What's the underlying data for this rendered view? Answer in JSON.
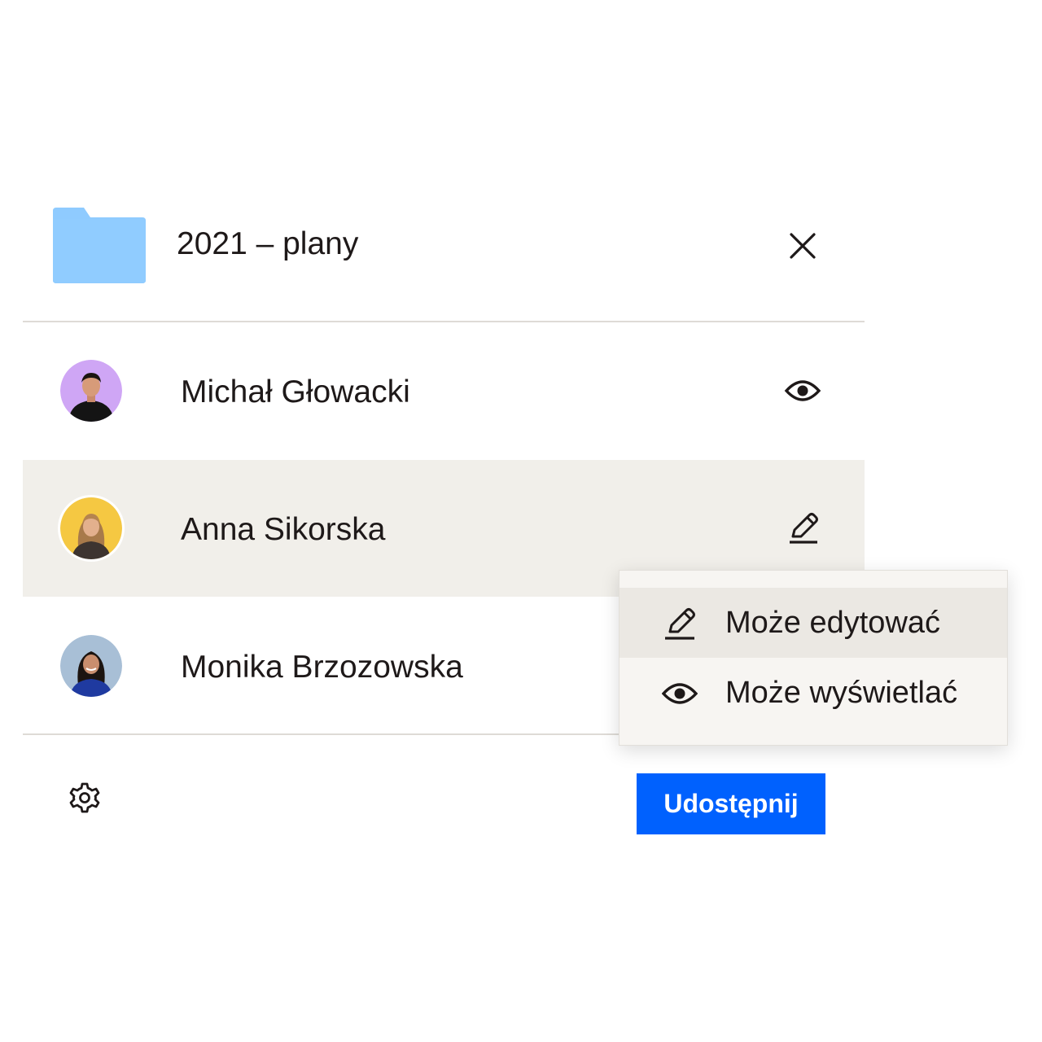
{
  "dialog": {
    "folder_name": "2021 – plany",
    "folder_icon": "folder-icon",
    "close_icon": "close-icon",
    "colors": {
      "folder": "#8fcbff",
      "accent": "#0061fe",
      "selected_row": "#f1efea"
    }
  },
  "members": [
    {
      "name": "Michał Głowacki",
      "permission_icon": "eye-icon",
      "avatar_color": "#cfa6f5"
    },
    {
      "name": "Anna Sikorska",
      "permission_icon": "pencil-icon",
      "avatar_color": "#f5c842",
      "selected": true
    },
    {
      "name": "Monika Brzozowska",
      "permission_icon": "",
      "avatar_color": "#a8bfd6"
    }
  ],
  "permission_menu": {
    "options": [
      {
        "label": "Może edytować",
        "icon": "pencil-icon",
        "highlighted": true
      },
      {
        "label": "Może wyświetlać",
        "icon": "eye-icon"
      }
    ]
  },
  "footer": {
    "settings_icon": "gear-icon",
    "share_label": "Udostępnij"
  }
}
